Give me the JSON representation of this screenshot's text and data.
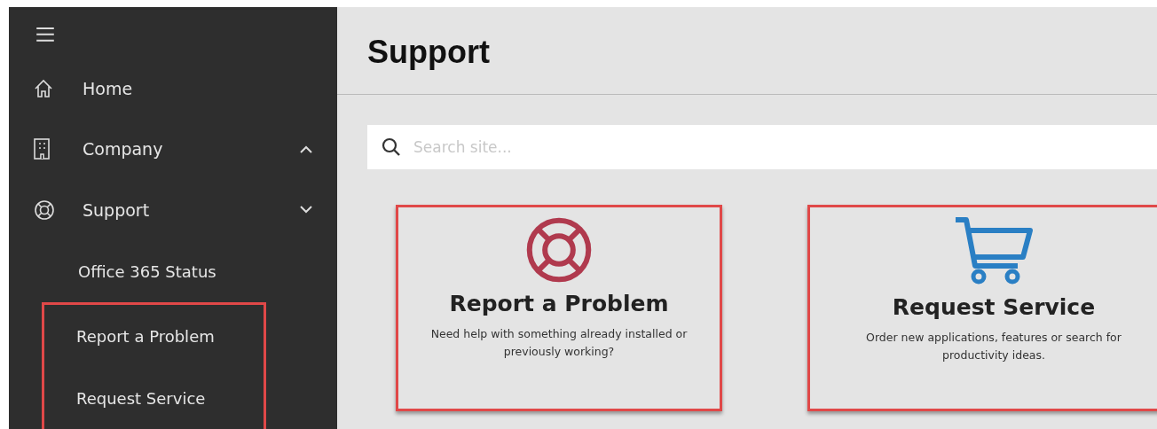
{
  "sidebar": {
    "items": [
      {
        "label": "Home",
        "kind": "home"
      },
      {
        "label": "Company",
        "kind": "building",
        "expanded": false
      },
      {
        "label": "Support",
        "kind": "lifebuoy",
        "expanded": true,
        "children": [
          {
            "label": "Office 365 Status",
            "highlighted": false
          },
          {
            "label": "Report a Problem",
            "highlighted": true
          },
          {
            "label": "Request Service",
            "highlighted": true
          }
        ]
      }
    ]
  },
  "page": {
    "title": "Support"
  },
  "search": {
    "placeholder": "Search site..."
  },
  "cards": [
    {
      "kind": "lifebuoy",
      "color": "#b03a4e",
      "title": "Report a Problem",
      "description": "Need help with something already installed or previously working?",
      "highlighted": true
    },
    {
      "kind": "cart",
      "color": "#2a7fc4",
      "title": "Request Service",
      "description": "Order new applications, features or search for productivity ideas.",
      "highlighted": true
    }
  ]
}
